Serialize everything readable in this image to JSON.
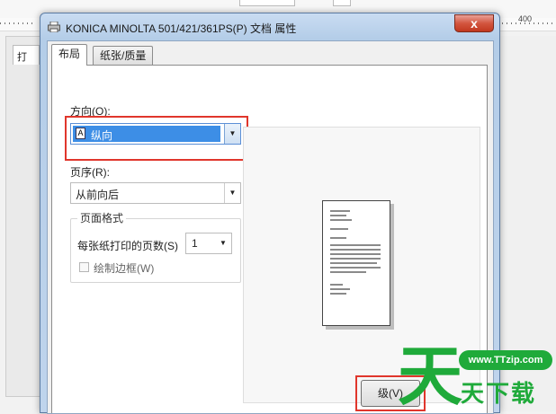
{
  "background": {
    "top_field_text": "3.0 mm",
    "ruler_number": "400",
    "side_tab_label": "打"
  },
  "dialog": {
    "title": "KONICA MINOLTA 501/421/361PS(P) 文档 属性",
    "close_label": "x",
    "tabs": [
      {
        "label": "布局",
        "active": true
      },
      {
        "label": "纸张/质量",
        "active": false
      }
    ],
    "orientation": {
      "label": "方向(O):",
      "value": "纵向",
      "icon_glyph": "A"
    },
    "page_order": {
      "label": "页序(R):",
      "value": "从前向后"
    },
    "page_format": {
      "group_title": "页面格式",
      "pages_per_sheet_label": "每张纸打印的页数(S)",
      "pages_per_sheet_value": "1",
      "draw_borders_label": "绘制边框(W)",
      "draw_borders_checked": false
    },
    "ok_button_label": "级(V)"
  },
  "watermark": {
    "glyph": "天",
    "url": "www.TTzip.com",
    "text": "天下载"
  },
  "colors": {
    "highlight_red": "#e0362c",
    "selection_blue": "#3d8ee6",
    "watermark_green": "#1faa3a"
  }
}
